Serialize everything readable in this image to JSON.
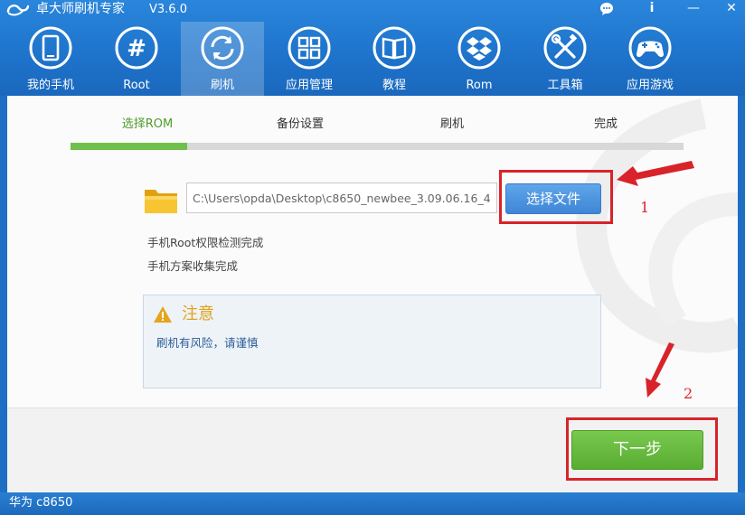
{
  "app": {
    "title": "卓大师刷机专家",
    "version": "V3.6.0"
  },
  "window_controls": {
    "chat_icon": "chat-bubble-icon",
    "info_label": "i",
    "minimize_label": "—",
    "close_label": "✕"
  },
  "nav": {
    "items": [
      {
        "label": "我的手机",
        "icon": "phone-icon",
        "active": false
      },
      {
        "label": "Root",
        "icon": "hash-icon",
        "active": false
      },
      {
        "label": "刷机",
        "icon": "refresh-icon",
        "active": true
      },
      {
        "label": "应用管理",
        "icon": "grid-icon",
        "active": false
      },
      {
        "label": "教程",
        "icon": "book-icon",
        "active": false
      },
      {
        "label": "Rom",
        "icon": "dropbox-icon",
        "active": false
      },
      {
        "label": "工具箱",
        "icon": "tools-icon",
        "active": false
      },
      {
        "label": "应用游戏",
        "icon": "gamepad-icon",
        "active": false
      }
    ]
  },
  "steps": [
    {
      "label": "选择ROM",
      "active": true
    },
    {
      "label": "备份设置",
      "active": false
    },
    {
      "label": "刷机",
      "active": false
    },
    {
      "label": "完成",
      "active": false
    }
  ],
  "progress": {
    "fraction": 0.19
  },
  "file_picker": {
    "path_value": "C:\\Users\\opda\\Desktop\\c8650_newbee_3.09.06.16_4",
    "button_label": "选择文件"
  },
  "status_messages": [
    "手机Root权限检测完成",
    "手机方案收集完成"
  ],
  "notice": {
    "title": "注意",
    "text": "刷机有风险，请谨慎"
  },
  "next_button": {
    "label": "下一步"
  },
  "annotations": {
    "label_1": "1",
    "label_2": "2"
  },
  "status_bar": {
    "device": "华为 c8650"
  },
  "colors": {
    "brand_blue": "#1f74cc",
    "active_green": "#4f9c2c",
    "progress_green": "#6fc04a",
    "button_blue": "#3f86d6",
    "notice_title": "#e2a21a",
    "annotation_red": "#d9232a"
  }
}
